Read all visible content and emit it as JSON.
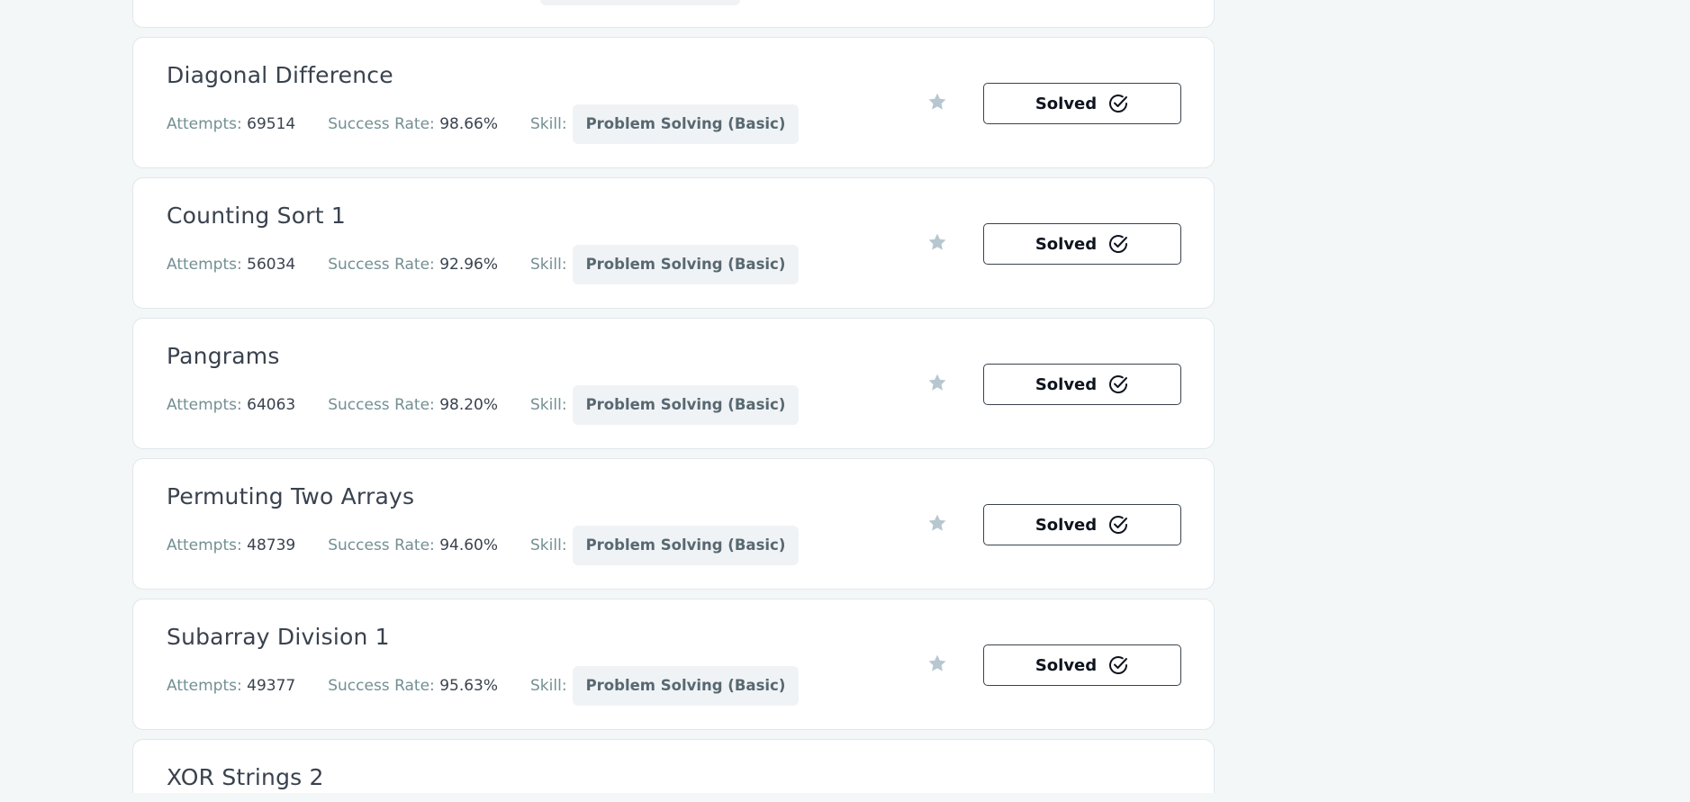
{
  "labels": {
    "attempts": "Attempts:",
    "success_rate": "Success Rate:",
    "skill": "Skill:"
  },
  "challenges": [
    {
      "title": "Diagonal Difference",
      "attempts": "69514",
      "success_rate": "98.66%",
      "skill": "Problem Solving (Basic)",
      "status": "Solved"
    },
    {
      "title": "Counting Sort 1",
      "attempts": "56034",
      "success_rate": "92.96%",
      "skill": "Problem Solving (Basic)",
      "status": "Solved"
    },
    {
      "title": "Pangrams",
      "attempts": "64063",
      "success_rate": "98.20%",
      "skill": "Problem Solving (Basic)",
      "status": "Solved"
    },
    {
      "title": "Permuting Two Arrays",
      "attempts": "48739",
      "success_rate": "94.60%",
      "skill": "Problem Solving (Basic)",
      "status": "Solved"
    },
    {
      "title": "Subarray Division 1",
      "attempts": "49377",
      "success_rate": "95.63%",
      "skill": "Problem Solving (Basic)",
      "status": "Solved"
    }
  ],
  "next_challenge": {
    "title": "XOR Strings 2"
  },
  "icons": {
    "star": "star-icon",
    "check": "check-circle-icon"
  },
  "colors": {
    "background": "#f3f7f7",
    "card": "#ffffff",
    "title": "#39424e",
    "muted": "#738f93",
    "star": "#b7c7cf",
    "chip": "#f0f3f5"
  }
}
